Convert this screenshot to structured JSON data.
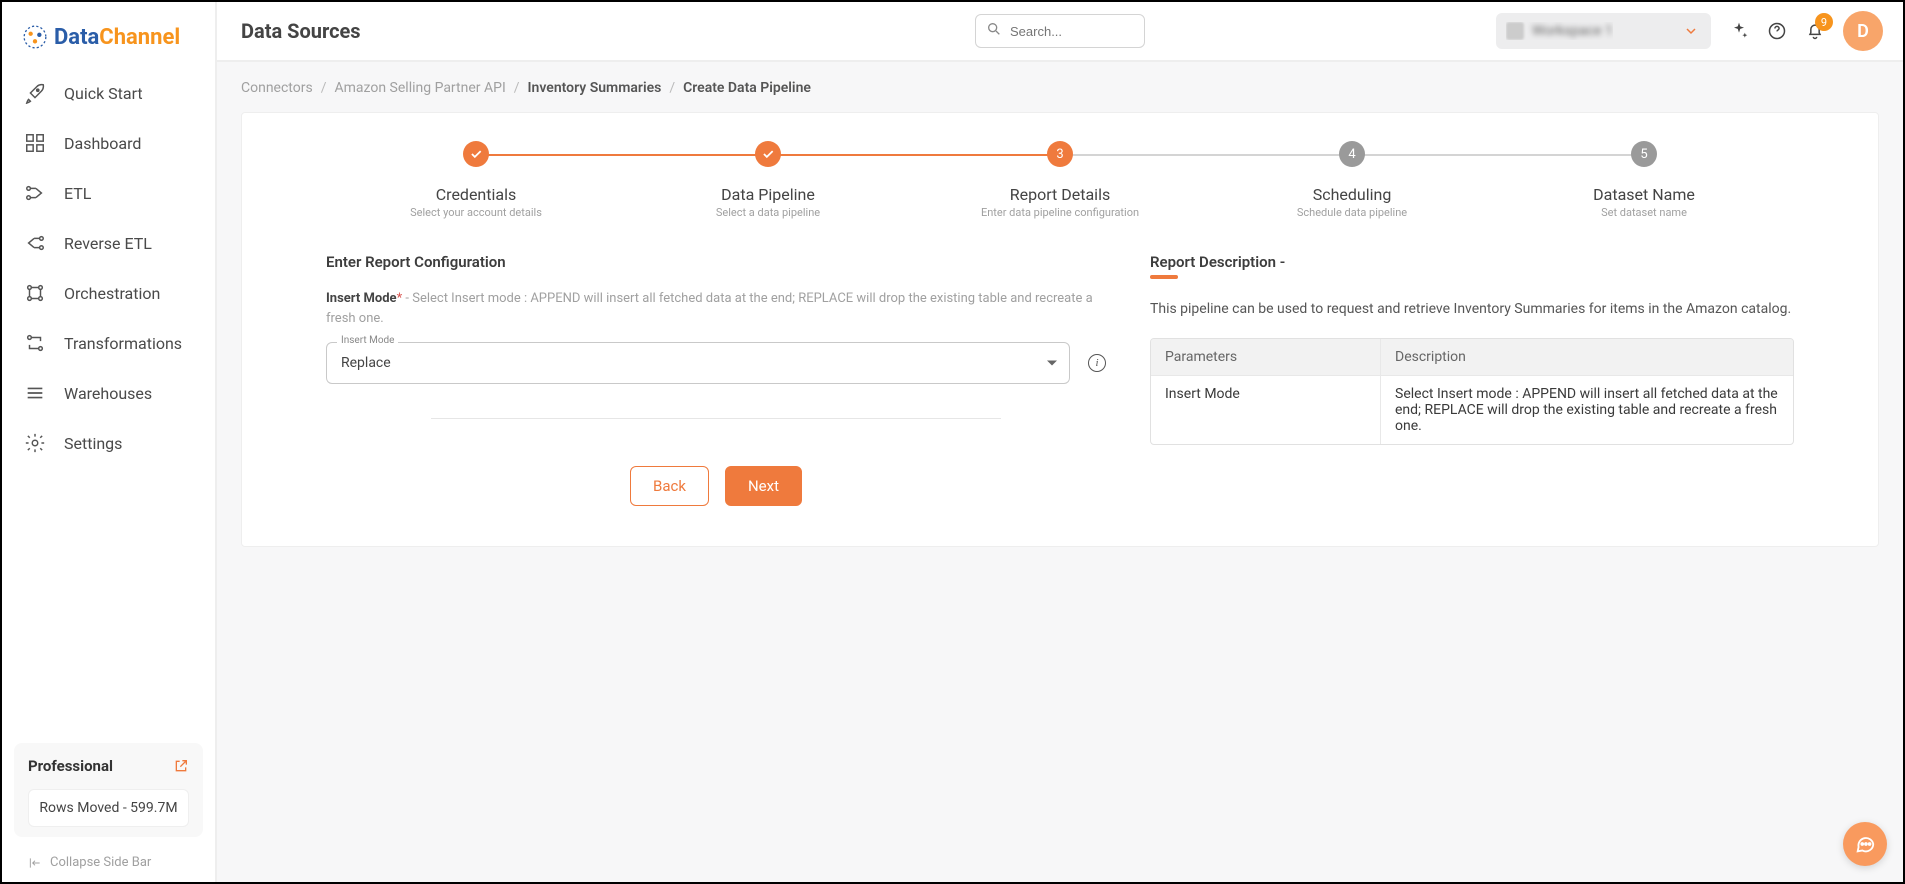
{
  "brand": {
    "first": "Data",
    "second": "Channel"
  },
  "sidebar": {
    "items": [
      {
        "label": "Quick Start"
      },
      {
        "label": "Dashboard"
      },
      {
        "label": "ETL"
      },
      {
        "label": "Reverse ETL"
      },
      {
        "label": "Orchestration"
      },
      {
        "label": "Transformations"
      },
      {
        "label": "Warehouses"
      },
      {
        "label": "Settings"
      }
    ],
    "plan": {
      "title": "Professional",
      "rows_info": "Rows Moved - 599.7M"
    },
    "collapse_label": "Collapse Side Bar"
  },
  "header": {
    "title": "Data Sources",
    "search_placeholder": "Search...",
    "workspace_label": "Workspace 1",
    "notif_count": "9",
    "avatar_letter": "D"
  },
  "breadcrumb": {
    "c1": "Connectors",
    "c2": "Amazon Selling Partner API",
    "c3": "Inventory Summaries",
    "c4": "Create Data Pipeline"
  },
  "stepper": {
    "steps": [
      {
        "num": "",
        "title": "Credentials",
        "sub": "Select your account details"
      },
      {
        "num": "",
        "title": "Data Pipeline",
        "sub": "Select a data pipeline"
      },
      {
        "num": "3",
        "title": "Report Details",
        "sub": "Enter data pipeline configuration"
      },
      {
        "num": "4",
        "title": "Scheduling",
        "sub": "Schedule data pipeline"
      },
      {
        "num": "5",
        "title": "Dataset Name",
        "sub": "Set dataset name"
      }
    ]
  },
  "form": {
    "section_heading": "Enter Report Configuration",
    "insert_mode": {
      "label": "Insert Mode",
      "hint": "- Select Insert mode : APPEND will insert all fetched data at the end; REPLACE will drop the existing table and recreate a fresh one.",
      "float_label": "Insert Mode",
      "value": "Replace"
    },
    "back_label": "Back",
    "next_label": "Next"
  },
  "report": {
    "title": "Report Description -",
    "text": "This pipeline can be used to request and retrieve Inventory Summaries for items in the Amazon catalog.",
    "table": {
      "head": {
        "c1": "Parameters",
        "c2": "Description"
      },
      "rows": [
        {
          "c1": "Insert Mode",
          "c2": "Select Insert mode : APPEND will insert all fetched data at the end; REPLACE will drop the existing table and recreate a fresh one."
        }
      ]
    }
  }
}
